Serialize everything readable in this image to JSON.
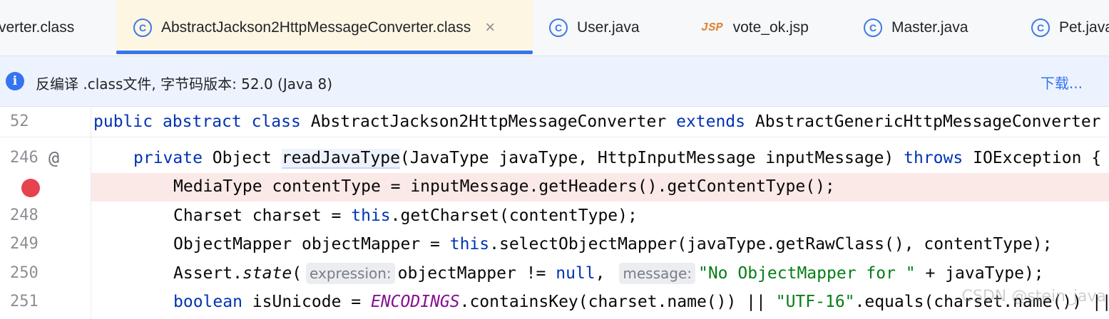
{
  "tabs": [
    {
      "label": "verter.class",
      "icon": "class-icon"
    },
    {
      "label": "AbstractJackson2HttpMessageConverter.class",
      "icon": "class-icon",
      "active": true,
      "close": "×"
    },
    {
      "label": "User.java",
      "icon": "class-icon"
    },
    {
      "label": "vote_ok.jsp",
      "icon": "jsp-icon",
      "icon_text": "JSP"
    },
    {
      "label": "Master.java",
      "icon": "class-icon"
    },
    {
      "label": "Pet.java",
      "icon": "class-icon"
    }
  ],
  "banner": {
    "message": "反编译 .class文件, 字节码版本: 52.0 (Java 8)",
    "download_link": "下载..."
  },
  "editor": {
    "lines": [
      {
        "num": "52"
      },
      {
        "num": "246"
      },
      {
        "num": ""
      },
      {
        "num": "248"
      },
      {
        "num": "249"
      },
      {
        "num": "250"
      },
      {
        "num": "251"
      }
    ],
    "code": {
      "l52": {
        "t1": "public",
        "t2": "abstract",
        "t3": "class",
        "t4": "AbstractJackson2HttpMessageConverter",
        "t5": "extends",
        "t6": "AbstractGenericHttpMessageConverter"
      },
      "l246": {
        "t1": "private",
        "t2": "Object",
        "t3": "readJavaType",
        "t4": "(JavaType javaType, HttpInputMessage inputMessage)",
        "t5": "throws",
        "t6": "IOException {"
      },
      "l247": {
        "t1": "MediaType contentType = inputMessage.getHeaders().getContentType();"
      },
      "l248": {
        "t1": "Charset charset =",
        "t2": "this",
        "t3": ".getCharset(contentType);"
      },
      "l249": {
        "t1": "ObjectMapper objectMapper =",
        "t2": "this",
        "t3": ".selectObjectMapper(javaType.getRawClass(), contentType);"
      },
      "l250": {
        "t1": "Assert.",
        "t2": "state",
        "t3": "(",
        "hint1": "expression:",
        "t4": "objectMapper !=",
        "t5": "null",
        "t6": ",",
        "hint2": "message:",
        "t7": "\"No ObjectMapper for \"",
        "t8": "+ javaType);"
      },
      "l251": {
        "t1": "boolean",
        "t2": "isUnicode =",
        "t3": "ENCODINGS",
        "t4": ".containsKey(charset.name()) ||",
        "t5": "\"UTF-16\"",
        "t6": ".equals(charset.name()) ||"
      }
    }
  },
  "watermark": "CSDN @stein_java",
  "colors": {
    "keyword": "#0033b3",
    "string": "#067d17",
    "constant": "#871094",
    "accent": "#3574f0",
    "breakpoint": "#e5444f"
  }
}
